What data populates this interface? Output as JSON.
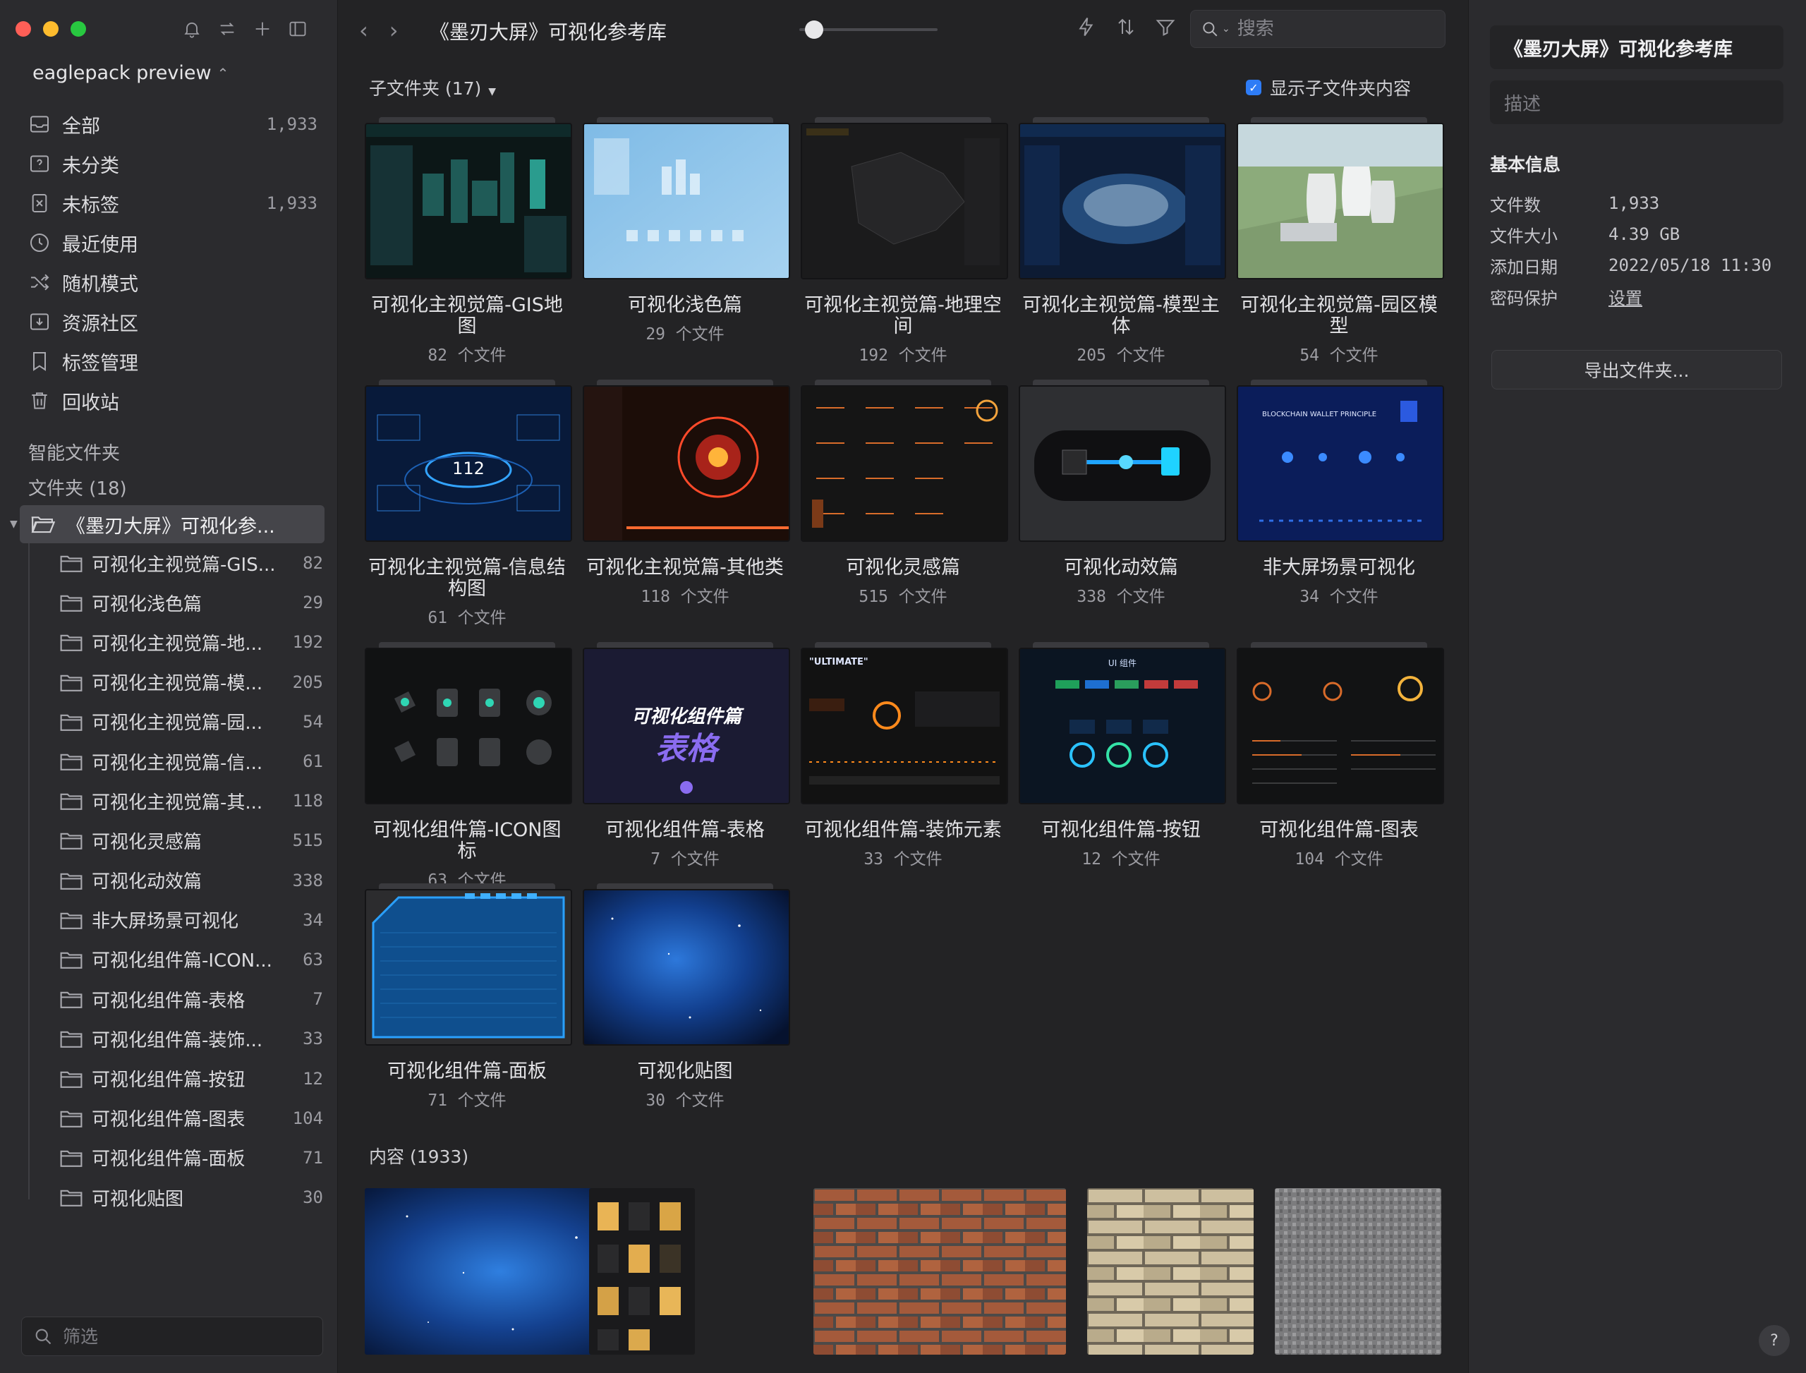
{
  "sidebar": {
    "library_name": "eaglepack preview",
    "nav": [
      {
        "label": "全部",
        "count": "1,933"
      },
      {
        "label": "未分类",
        "count": ""
      },
      {
        "label": "未标签",
        "count": "1,933"
      },
      {
        "label": "最近使用",
        "count": ""
      },
      {
        "label": "随机模式",
        "count": ""
      },
      {
        "label": "资源社区",
        "count": ""
      },
      {
        "label": "标签管理",
        "count": ""
      },
      {
        "label": "回收站",
        "count": ""
      }
    ],
    "smart_folders_label": "智能文件夹",
    "folders_label": "文件夹 (18)",
    "root_folder": "《墨刃大屏》可视化参...",
    "children": [
      {
        "label": "可视化主视觉篇-GIS...",
        "count": "82"
      },
      {
        "label": "可视化浅色篇",
        "count": "29"
      },
      {
        "label": "可视化主视觉篇-地...",
        "count": "192"
      },
      {
        "label": "可视化主视觉篇-模...",
        "count": "205"
      },
      {
        "label": "可视化主视觉篇-园...",
        "count": "54"
      },
      {
        "label": "可视化主视觉篇-信...",
        "count": "61"
      },
      {
        "label": "可视化主视觉篇-其...",
        "count": "118"
      },
      {
        "label": "可视化灵感篇",
        "count": "515"
      },
      {
        "label": "可视化动效篇",
        "count": "338"
      },
      {
        "label": "非大屏场景可视化",
        "count": "34"
      },
      {
        "label": "可视化组件篇-ICON...",
        "count": "63"
      },
      {
        "label": "可视化组件篇-表格",
        "count": "7"
      },
      {
        "label": "可视化组件篇-装饰...",
        "count": "33"
      },
      {
        "label": "可视化组件篇-按钮",
        "count": "12"
      },
      {
        "label": "可视化组件篇-图表",
        "count": "104"
      },
      {
        "label": "可视化组件篇-面板",
        "count": "71"
      },
      {
        "label": "可视化贴图",
        "count": "30"
      }
    ],
    "filter_placeholder": "筛选"
  },
  "toolbar": {
    "title": "《墨刃大屏》可视化参考库",
    "search_placeholder": "搜索"
  },
  "main": {
    "subfolder_header": "子文件夹 (17)",
    "show_subfolder_label": "显示子文件夹内容",
    "file_unit": "个文件",
    "folders": [
      {
        "name": "可视化主视觉篇-GIS地图",
        "count": "82"
      },
      {
        "name": "可视化浅色篇",
        "count": "29"
      },
      {
        "name": "可视化主视觉篇-地理空间",
        "count": "192"
      },
      {
        "name": "可视化主视觉篇-模型主体",
        "count": "205"
      },
      {
        "name": "可视化主视觉篇-园区模型",
        "count": "54"
      },
      {
        "name": "可视化主视觉篇-信息结构图",
        "count": "61"
      },
      {
        "name": "可视化主视觉篇-其他类",
        "count": "118"
      },
      {
        "name": "可视化灵感篇",
        "count": "515"
      },
      {
        "name": "可视化动效篇",
        "count": "338"
      },
      {
        "name": "非大屏场景可视化",
        "count": "34"
      },
      {
        "name": "可视化组件篇-ICON图标",
        "count": "63"
      },
      {
        "name": "可视化组件篇-表格",
        "count": "7"
      },
      {
        "name": "可视化组件篇-装饰元素",
        "count": "33"
      },
      {
        "name": "可视化组件篇-按钮",
        "count": "12"
      },
      {
        "name": "可视化组件篇-图表",
        "count": "104"
      },
      {
        "name": "可视化组件篇-面板",
        "count": "71"
      },
      {
        "name": "可视化贴图",
        "count": "30"
      }
    ],
    "thumb_text": {
      "info_center": "112",
      "table_title": "可视化组件篇",
      "table_big": "表格",
      "blockchain": "BLOCKCHAIN WALLET PRINCIPLE",
      "ultimate": "\"ULTIMATE\"",
      "ui_label": "UI 组件"
    },
    "content_header": "内容 (1933)"
  },
  "inspector": {
    "title": "《墨刃大屏》可视化参考库",
    "desc_placeholder": "描述",
    "section": "基本信息",
    "rows": [
      {
        "key": "文件数",
        "value": "1,933"
      },
      {
        "key": "文件大小",
        "value": "4.39 GB"
      },
      {
        "key": "添加日期",
        "value": "2022/05/18 11:30"
      },
      {
        "key": "密码保护",
        "value": "设置"
      }
    ],
    "export_label": "导出文件夹...",
    "help": "?"
  }
}
